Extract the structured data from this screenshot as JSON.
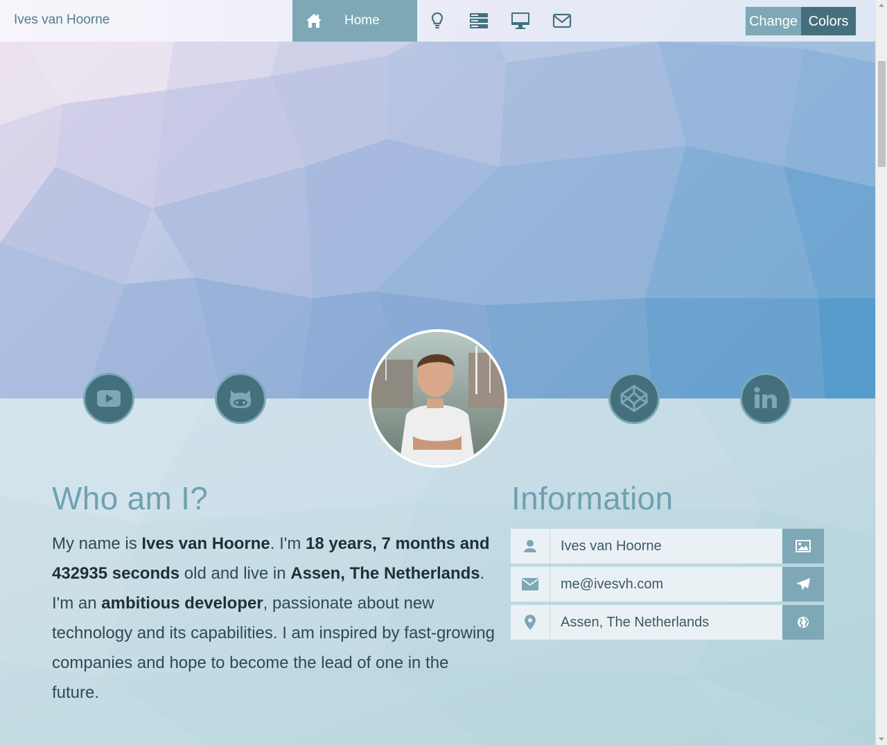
{
  "nav": {
    "brand": "Ives van Hoorne",
    "home_label": "Home",
    "icons": [
      "lightbulb-icon",
      "server-icon",
      "desktop-icon",
      "envelope-icon"
    ],
    "change_colors": {
      "part1": "Change",
      "part2": "Colors"
    }
  },
  "social": [
    "youtube-icon",
    "github-icon",
    "codepen-icon",
    "linkedin-icon"
  ],
  "about": {
    "title": "Who am I?",
    "t1": "My name is ",
    "b1": "Ives van Hoorne",
    "t2": ". I'm ",
    "b2": "18 years, 7 months and 432935 seconds",
    "t3": " old and live in ",
    "b3": "Assen, The Netherlands",
    "t4": ". I'm an ",
    "b4": "ambitious developer",
    "t5": ", passionate about new technology and its capabilities. I am inspired by fast-growing companies and hope to become the lead of one in the future."
  },
  "information": {
    "title": "Information",
    "rows": [
      {
        "icon": "user-icon",
        "value": "Ives van Hoorne",
        "action_icon": "image-icon"
      },
      {
        "icon": "envelope-icon",
        "value": "me@ivesvh.com",
        "action_icon": "paper-plane-icon"
      },
      {
        "icon": "map-marker-icon",
        "value": "Assen, The Netherlands",
        "action_icon": "globe-icon"
      }
    ]
  },
  "colors": {
    "accent": "#7ea8b5",
    "dark_accent": "#44707e",
    "heading": "#6fa1b1"
  }
}
